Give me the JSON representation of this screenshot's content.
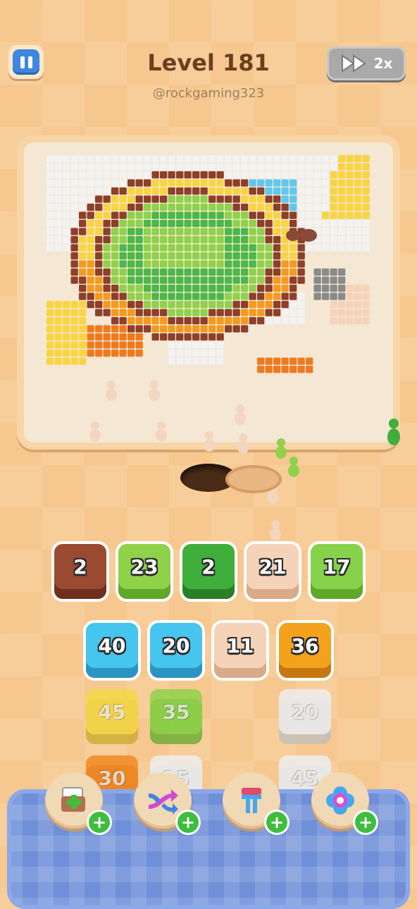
{
  "header": {
    "title": "Level 181",
    "handle": "@rockgaming323",
    "pause_icon": "pause-icon",
    "speed_label": "2x",
    "speed_icon": "fast-forward-icon"
  },
  "colors": {
    "brown": "#9b4a32",
    "lime": "#8fd24a",
    "green": "#3fae3a",
    "peach": "#f5d3b8",
    "light_green": "#86d24a",
    "cyan": "#46c5ef",
    "orange": "#f4a21e",
    "yellow": "#f7d84a",
    "white": "#eeeeee",
    "deep_orange": "#f18a23"
  },
  "active_row": [
    {
      "count": "2",
      "color": "brown"
    },
    {
      "count": "23",
      "color": "lime"
    },
    {
      "count": "2",
      "color": "green"
    },
    {
      "count": "21",
      "color": "peach"
    },
    {
      "count": "17",
      "color": "light_green"
    }
  ],
  "queue_rows": [
    [
      {
        "count": "40",
        "color": "cyan"
      },
      {
        "count": "20",
        "color": "cyan"
      },
      {
        "count": "11",
        "color": "peach"
      },
      {
        "count": "36",
        "color": "orange"
      }
    ],
    [
      {
        "count": "45",
        "color": "yellow"
      },
      {
        "count": "35",
        "color": "lime"
      },
      {
        "count": "20",
        "color": "white"
      }
    ],
    [
      {
        "count": "30",
        "color": "deep_orange"
      },
      {
        "count": "25",
        "color": "white"
      },
      {
        "count": "45",
        "color": "white"
      }
    ]
  ],
  "boosters": [
    {
      "icon": "add-slot-icon",
      "plus": "+"
    },
    {
      "icon": "shuffle-arrows-icon",
      "plus": "+"
    },
    {
      "icon": "magnet-icon",
      "plus": "+"
    },
    {
      "icon": "spool-icon",
      "plus": "+"
    }
  ]
}
